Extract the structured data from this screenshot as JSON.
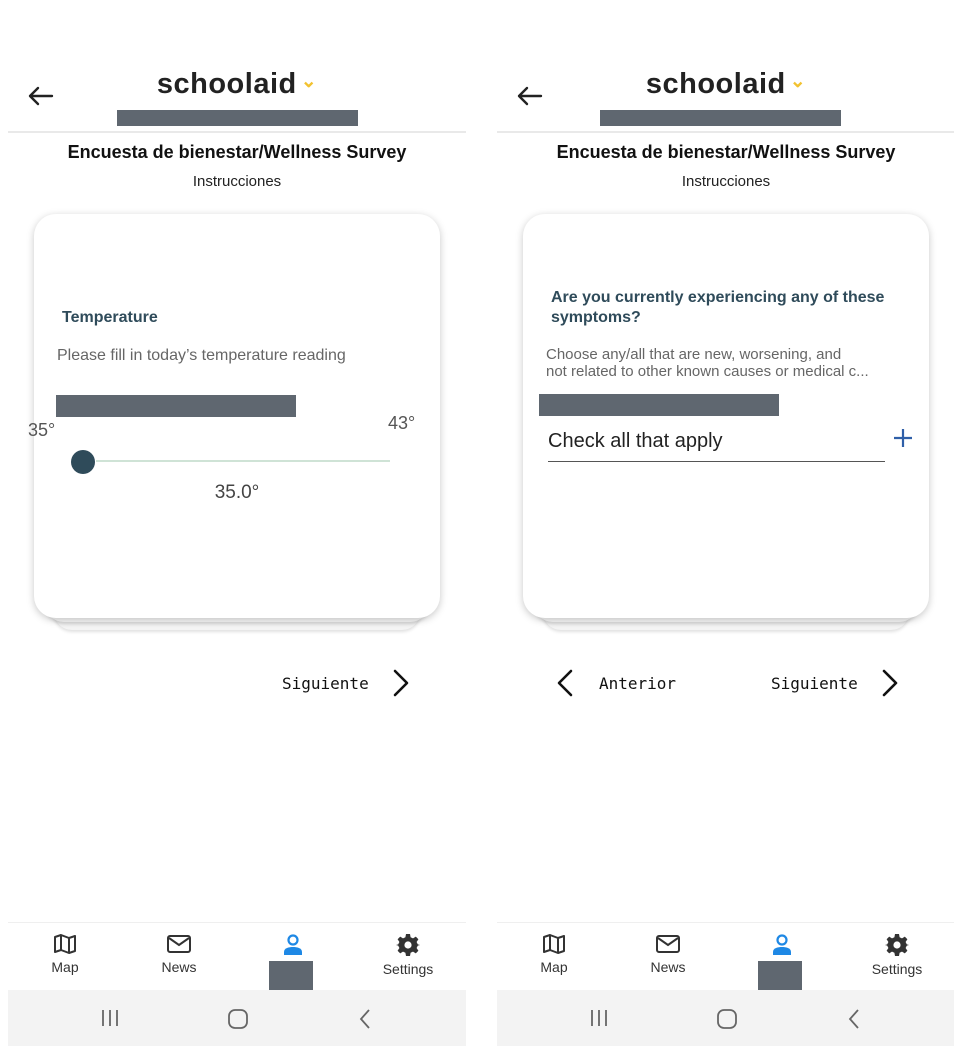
{
  "app": {
    "logo_text": "schoolaid",
    "logo_chevron": "⌄",
    "brand_color": "#f2c230",
    "accent_color": "#2f4b5a"
  },
  "screens": [
    {
      "title": "Encuesta de bienestar/Wellness Survey",
      "subtitle": "Instrucciones",
      "question": {
        "title": "Temperature",
        "description": "Please fill in today’s temperature reading",
        "slider": {
          "min_label": "35°",
          "max_label": "43°",
          "value_label": "35.0°",
          "min": 35,
          "max": 43,
          "value": 35.0
        }
      },
      "nav": {
        "next_label": "Siguiente"
      }
    },
    {
      "title": "Encuesta de bienestar/Wellness Survey",
      "subtitle": "Instrucciones",
      "question": {
        "title_line1": "Are you currently experiencing any of these",
        "title_line2": "symptoms?",
        "desc_line1": "Choose any/all that are new, worsening, and",
        "desc_line2": "not related to other known causes or medical c...",
        "field_label": "Check all that apply"
      },
      "nav": {
        "prev_label": "Anterior",
        "next_label": "Siguiente"
      }
    }
  ],
  "bottom_nav": {
    "items": [
      {
        "label": "Map",
        "icon": "map-icon"
      },
      {
        "label": "News",
        "icon": "mail-icon"
      },
      {
        "label": "",
        "icon": "person-icon",
        "active_color": "#1e88e5"
      },
      {
        "label": "Settings",
        "icon": "gear-icon"
      }
    ]
  },
  "system_bar": {
    "icons": [
      "recents-icon",
      "home-icon",
      "back-icon"
    ]
  }
}
